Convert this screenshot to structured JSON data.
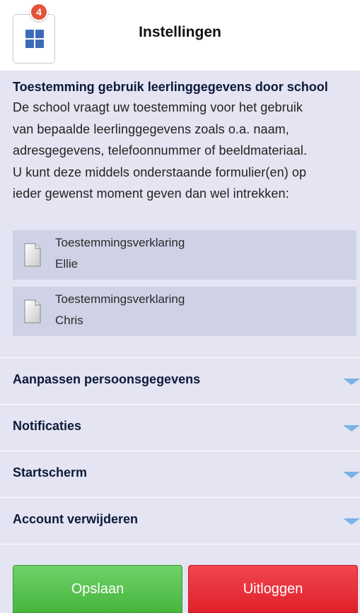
{
  "header": {
    "title": "Instellingen",
    "menu_badge": "4"
  },
  "consent": {
    "title": "Toestemming gebruik leerlinggegevens door school",
    "lines": [
      "De school vraagt uw toestemming voor het gebruik",
      "van bepaalde leerlinggegevens zoals o.a. naam,",
      "adresgegevens, telefoonnummer of beeldmateriaal.",
      "U kunt deze middels onderstaande formulier(en) op",
      "ieder gewenst moment geven dan wel intrekken:"
    ],
    "documents": [
      {
        "title": "Toestemmingsverklaring",
        "name": "Ellie",
        "icon": "document-icon"
      },
      {
        "title": "Toestemmingsverklaring",
        "name": "Chris",
        "icon": "document-icon"
      }
    ]
  },
  "sections": [
    {
      "label": "Aanpassen persoonsgegevens",
      "icon": "chevron-down-icon"
    },
    {
      "label": "Notificaties",
      "icon": "chevron-down-icon"
    },
    {
      "label": "Startscherm",
      "icon": "chevron-down-icon"
    },
    {
      "label": "Account verwijderen",
      "icon": "chevron-down-icon"
    }
  ],
  "actions": {
    "save_label": "Opslaan",
    "logout_label": "Uitloggen"
  },
  "colors": {
    "background": "#e4e4f2",
    "document_bg": "#cfd2e6",
    "badge": "#e2533a",
    "save": "#46b53e",
    "logout": "#df1f2a",
    "chevron": "#79b3e8"
  }
}
